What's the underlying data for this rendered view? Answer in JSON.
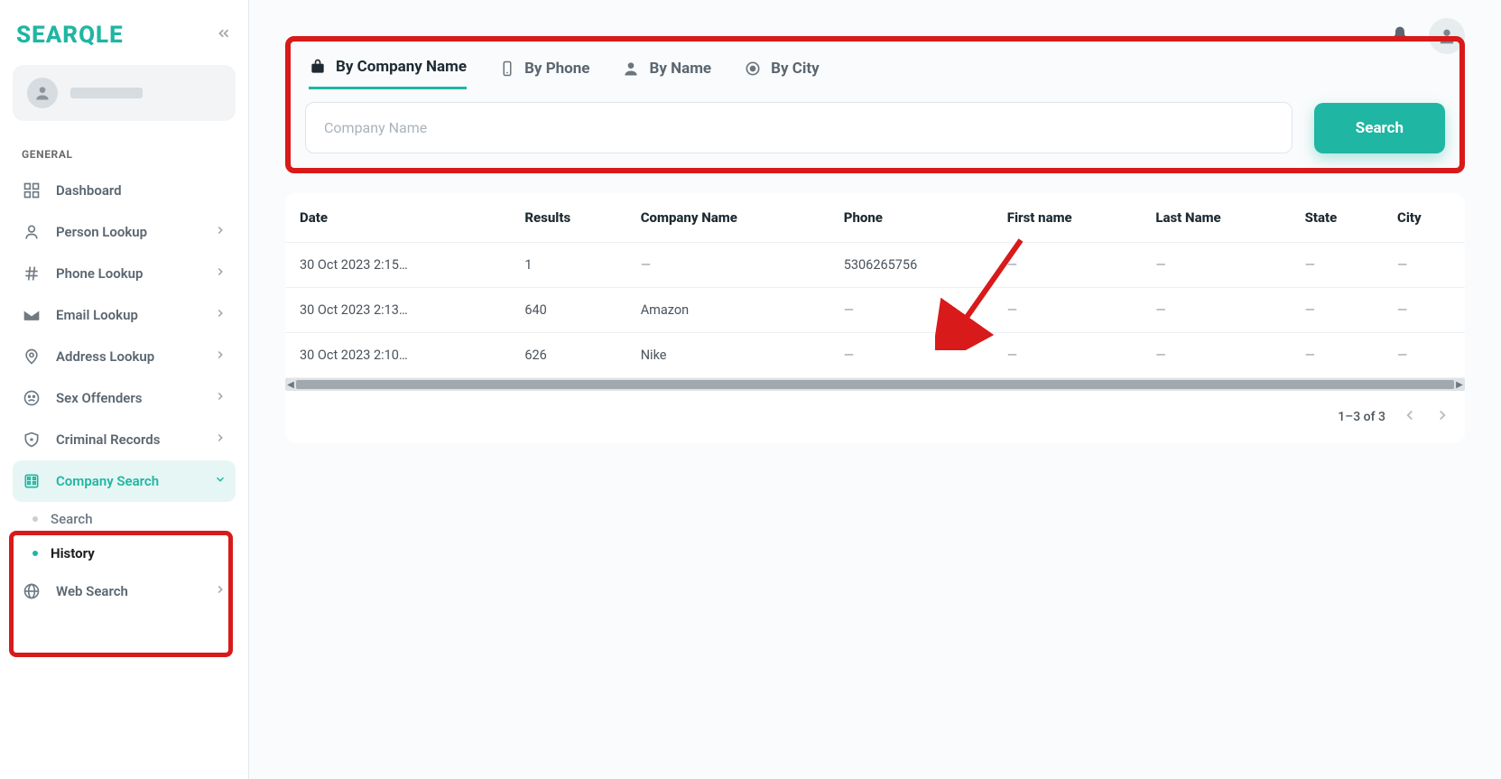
{
  "brand": "SEARQLE",
  "sidebar": {
    "section": "GENERAL",
    "items": [
      {
        "label": "Dashboard"
      },
      {
        "label": "Person Lookup"
      },
      {
        "label": "Phone Lookup"
      },
      {
        "label": "Email Lookup"
      },
      {
        "label": "Address Lookup"
      },
      {
        "label": "Sex Offenders"
      },
      {
        "label": "Criminal Records"
      },
      {
        "label": "Company Search"
      },
      {
        "label": "Web Search"
      }
    ],
    "sub": {
      "search": "Search",
      "history": "History"
    }
  },
  "tabs": {
    "company": "By Company Name",
    "phone": "By Phone",
    "name": "By Name",
    "city": "By City"
  },
  "search": {
    "placeholder": "Company Name",
    "button": "Search"
  },
  "table": {
    "headers": [
      "Date",
      "Results",
      "Company Name",
      "Phone",
      "First name",
      "Last Name",
      "State",
      "City"
    ],
    "rows": [
      {
        "date": "30 Oct 2023 2:15…",
        "results": "1",
        "company": "—",
        "phone": "5306265756",
        "first": "—",
        "last": "—",
        "state": "—",
        "city": "—"
      },
      {
        "date": "30 Oct 2023 2:13…",
        "results": "640",
        "company": "Amazon",
        "phone": "—",
        "first": "—",
        "last": "—",
        "state": "—",
        "city": "—"
      },
      {
        "date": "30 Oct 2023 2:10…",
        "results": "626",
        "company": "Nike",
        "phone": "—",
        "first": "—",
        "last": "—",
        "state": "—",
        "city": "—"
      }
    ]
  },
  "pager": "1–3 of 3"
}
